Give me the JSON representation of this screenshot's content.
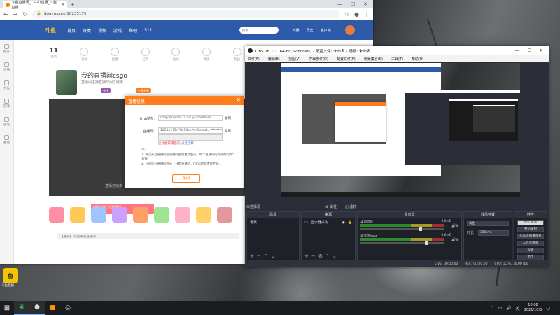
{
  "browser": {
    "tab_title": "斗鱼直播间_CSGO直播_斗鱼直播",
    "url": "douyu.com/10235175",
    "new_tab": "+",
    "win_min": "—",
    "win_max": "☐",
    "win_close": "✕"
  },
  "douyu": {
    "logo": "斗鱼",
    "nav": [
      "首页",
      "分类",
      "视频",
      "游戏",
      "鱼吧",
      "S11"
    ],
    "search_placeholder": "搜索",
    "top_icons": [
      "开播",
      "历史",
      "客户端"
    ],
    "side_items": [
      "推荐",
      "直播",
      "分类",
      "游戏",
      "鱼吧",
      "赛事"
    ],
    "stats": [
      {
        "value": "11",
        "label": "签到"
      },
      {
        "value": "",
        "label": "活动"
      },
      {
        "value": "",
        "label": "鱼塘"
      },
      {
        "value": "",
        "label": "任务"
      },
      {
        "value": "",
        "label": "鱼丸"
      },
      {
        "value": "",
        "label": "贵族"
      },
      {
        "value": "",
        "label": "粉丝"
      },
      {
        "value": "",
        "label": "背包"
      },
      {
        "value": "",
        "label": "竞猜"
      },
      {
        "value": "",
        "label": "分享"
      },
      {
        "value": "",
        "label": "更多"
      }
    ],
    "room_title": "我的直播间csgo",
    "room_sub": "直播间主播直播时间已结束",
    "chips": [
      "关注",
      "主播名称"
    ],
    "player_note": "直播已结束",
    "promo": "点赞送好礼 开启直播间",
    "chat_hint": "【通知】 欢迎来到直播间"
  },
  "dialog": {
    "title": "直播信息",
    "close": "✕",
    "rtmp_label": "rtmp地址:",
    "rtmp_value": "rtmp://sendtc3a.douyu.com/live",
    "code_label": "直播码:",
    "code_value": "10235175rFKUS0pk?wsSecret=********",
    "copy": "复制",
    "red_note": "启动推荐播后的",
    "link_note": "点此了解",
    "notes": "注:\n1. 每次开启直播间后直播码都会重新生成，每个直播码的有效期约为5分钟。\n2. 只有您在直播间点击了开始直播后，rtmp地址才会生效。",
    "button": "关闭"
  },
  "obs": {
    "title": "OBS 26.1.1 (64-bit, windows) - 配置文件: 未命名 - 场景: 未命名",
    "menu": [
      "文件(F)",
      "编辑(E)",
      "视图(V)",
      "停靠部件(D)",
      "配置文件(P)",
      "场景集合(S)",
      "工具(T)",
      "帮助(H)"
    ],
    "source_none": "未选择源",
    "properties": "⚙ 属性",
    "filters": "◫ 滤镜",
    "panels": [
      "场景",
      "来源",
      "混音器",
      "转场特效",
      "控件"
    ],
    "scene": "场景",
    "source": "显示器采集",
    "mix": [
      {
        "name": "桌面音频",
        "db": "0.0 dB",
        "level": 0.72
      },
      {
        "name": "麦克风/Aux",
        "db": "0.0 dB",
        "level": 0.78
      }
    ],
    "transition": "淡出",
    "duration_label": "时长",
    "duration": "300 ms",
    "controls": [
      "停止推流",
      "开始录制",
      "启动虚拟摄像机",
      "工作室模式",
      "设置",
      "退出"
    ],
    "status": [
      "LIVE: 00:00:00",
      "REC: 00:00:00",
      "CPU: 1.2%, 30.00 fps"
    ]
  },
  "float_label": "斗鱼直播",
  "taskbar": {
    "time": "16:08",
    "date": "2021/10/5",
    "ime": "英"
  }
}
